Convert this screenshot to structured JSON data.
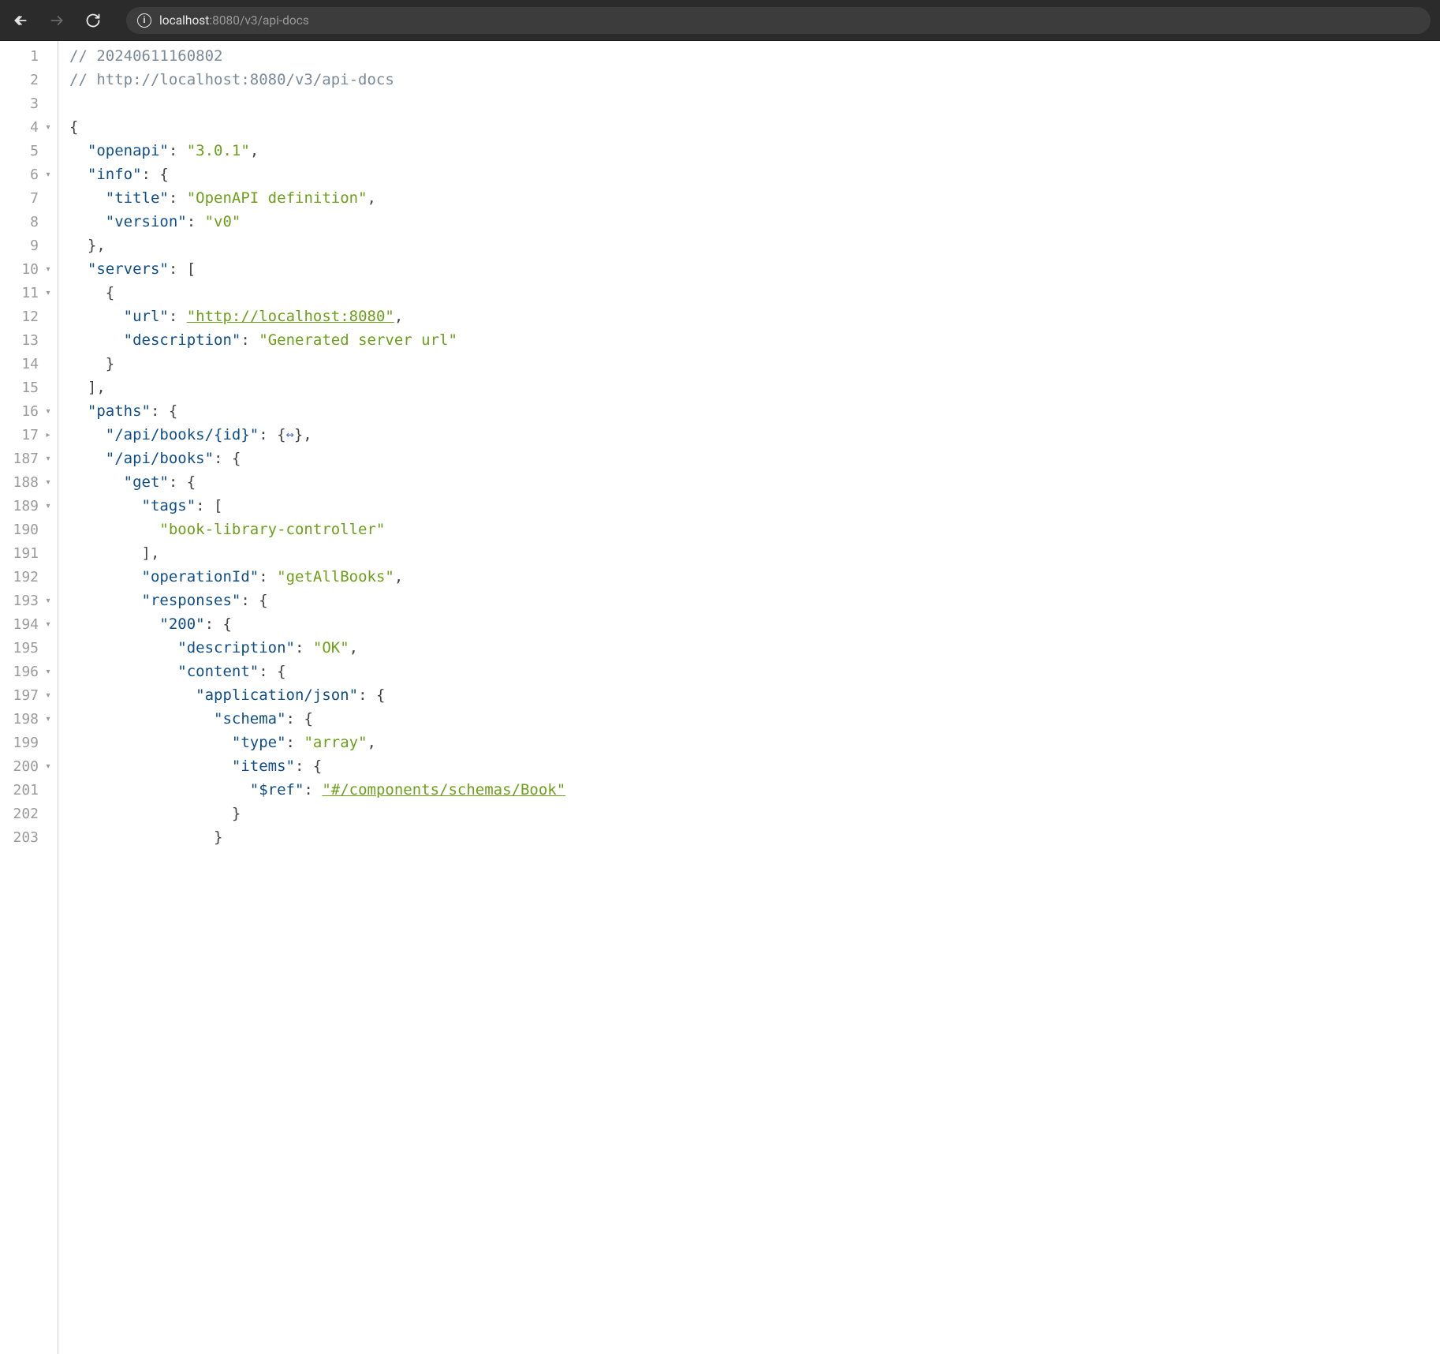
{
  "browser": {
    "url_host_prefix": "localhost",
    "url_host_suffix": ":8080",
    "url_path": "/v3/api-docs"
  },
  "lines": [
    {
      "n": "1",
      "fold": "",
      "tokens": [
        [
          "comment",
          "// 20240611160802"
        ]
      ]
    },
    {
      "n": "2",
      "fold": "",
      "tokens": [
        [
          "comment",
          "// http://localhost:8080/v3/api-docs"
        ]
      ]
    },
    {
      "n": "3",
      "fold": "",
      "tokens": []
    },
    {
      "n": "4",
      "fold": "▾",
      "tokens": [
        [
          "punct",
          "{"
        ]
      ]
    },
    {
      "n": "5",
      "fold": "",
      "tokens": [
        [
          "indent",
          "  "
        ],
        [
          "key",
          "\"openapi\""
        ],
        [
          "colon",
          ": "
        ],
        [
          "string",
          "\"3.0.1\""
        ],
        [
          "punct",
          ","
        ]
      ]
    },
    {
      "n": "6",
      "fold": "▾",
      "tokens": [
        [
          "indent",
          "  "
        ],
        [
          "key",
          "\"info\""
        ],
        [
          "colon",
          ": "
        ],
        [
          "punct",
          "{"
        ]
      ]
    },
    {
      "n": "7",
      "fold": "",
      "tokens": [
        [
          "indent",
          "    "
        ],
        [
          "key",
          "\"title\""
        ],
        [
          "colon",
          ": "
        ],
        [
          "string",
          "\"OpenAPI definition\""
        ],
        [
          "punct",
          ","
        ]
      ]
    },
    {
      "n": "8",
      "fold": "",
      "tokens": [
        [
          "indent",
          "    "
        ],
        [
          "key",
          "\"version\""
        ],
        [
          "colon",
          ": "
        ],
        [
          "string",
          "\"v0\""
        ]
      ]
    },
    {
      "n": "9",
      "fold": "",
      "tokens": [
        [
          "indent",
          "  "
        ],
        [
          "punct",
          "}"
        ],
        [
          "punct",
          ","
        ]
      ]
    },
    {
      "n": "10",
      "fold": "▾",
      "tokens": [
        [
          "indent",
          "  "
        ],
        [
          "key",
          "\"servers\""
        ],
        [
          "colon",
          ": "
        ],
        [
          "punct",
          "["
        ]
      ]
    },
    {
      "n": "11",
      "fold": "▾",
      "tokens": [
        [
          "indent",
          "    "
        ],
        [
          "punct",
          "{"
        ]
      ]
    },
    {
      "n": "12",
      "fold": "",
      "tokens": [
        [
          "indent",
          "      "
        ],
        [
          "key",
          "\"url\""
        ],
        [
          "colon",
          ": "
        ],
        [
          "link",
          "\"http://localhost:8080\""
        ],
        [
          "punct",
          ","
        ]
      ]
    },
    {
      "n": "13",
      "fold": "",
      "tokens": [
        [
          "indent",
          "      "
        ],
        [
          "key",
          "\"description\""
        ],
        [
          "colon",
          ": "
        ],
        [
          "string",
          "\"Generated server url\""
        ]
      ]
    },
    {
      "n": "14",
      "fold": "",
      "tokens": [
        [
          "indent",
          "    "
        ],
        [
          "punct",
          "}"
        ]
      ]
    },
    {
      "n": "15",
      "fold": "",
      "tokens": [
        [
          "indent",
          "  "
        ],
        [
          "punct",
          "]"
        ],
        [
          "punct",
          ","
        ]
      ]
    },
    {
      "n": "16",
      "fold": "▾",
      "tokens": [
        [
          "indent",
          "  "
        ],
        [
          "key",
          "\"paths\""
        ],
        [
          "colon",
          ": "
        ],
        [
          "punct",
          "{"
        ]
      ]
    },
    {
      "n": "17",
      "fold": "▸",
      "tokens": [
        [
          "indent",
          "    "
        ],
        [
          "key",
          "\"/api/books/{id}\""
        ],
        [
          "colon",
          ": "
        ],
        [
          "punct",
          "{"
        ],
        [
          "collapsed",
          "↔"
        ],
        [
          "punct",
          "}"
        ],
        [
          "punct",
          ","
        ]
      ]
    },
    {
      "n": "187",
      "fold": "▾",
      "tokens": [
        [
          "indent",
          "    "
        ],
        [
          "key",
          "\"/api/books\""
        ],
        [
          "colon",
          ": "
        ],
        [
          "punct",
          "{"
        ]
      ]
    },
    {
      "n": "188",
      "fold": "▾",
      "tokens": [
        [
          "indent",
          "      "
        ],
        [
          "key",
          "\"get\""
        ],
        [
          "colon",
          ": "
        ],
        [
          "punct",
          "{"
        ]
      ]
    },
    {
      "n": "189",
      "fold": "▾",
      "tokens": [
        [
          "indent",
          "        "
        ],
        [
          "key",
          "\"tags\""
        ],
        [
          "colon",
          ": "
        ],
        [
          "punct",
          "["
        ]
      ]
    },
    {
      "n": "190",
      "fold": "",
      "tokens": [
        [
          "indent",
          "          "
        ],
        [
          "string",
          "\"book-library-controller\""
        ]
      ]
    },
    {
      "n": "191",
      "fold": "",
      "tokens": [
        [
          "indent",
          "        "
        ],
        [
          "punct",
          "]"
        ],
        [
          "punct",
          ","
        ]
      ]
    },
    {
      "n": "192",
      "fold": "",
      "tokens": [
        [
          "indent",
          "        "
        ],
        [
          "key",
          "\"operationId\""
        ],
        [
          "colon",
          ": "
        ],
        [
          "string",
          "\"getAllBooks\""
        ],
        [
          "punct",
          ","
        ]
      ]
    },
    {
      "n": "193",
      "fold": "▾",
      "tokens": [
        [
          "indent",
          "        "
        ],
        [
          "key",
          "\"responses\""
        ],
        [
          "colon",
          ": "
        ],
        [
          "punct",
          "{"
        ]
      ]
    },
    {
      "n": "194",
      "fold": "▾",
      "tokens": [
        [
          "indent",
          "          "
        ],
        [
          "key",
          "\"200\""
        ],
        [
          "colon",
          ": "
        ],
        [
          "punct",
          "{"
        ]
      ]
    },
    {
      "n": "195",
      "fold": "",
      "tokens": [
        [
          "indent",
          "            "
        ],
        [
          "key",
          "\"description\""
        ],
        [
          "colon",
          ": "
        ],
        [
          "string",
          "\"OK\""
        ],
        [
          "punct",
          ","
        ]
      ]
    },
    {
      "n": "196",
      "fold": "▾",
      "tokens": [
        [
          "indent",
          "            "
        ],
        [
          "key",
          "\"content\""
        ],
        [
          "colon",
          ": "
        ],
        [
          "punct",
          "{"
        ]
      ]
    },
    {
      "n": "197",
      "fold": "▾",
      "tokens": [
        [
          "indent",
          "              "
        ],
        [
          "key",
          "\"application/json\""
        ],
        [
          "colon",
          ": "
        ],
        [
          "punct",
          "{"
        ]
      ]
    },
    {
      "n": "198",
      "fold": "▾",
      "tokens": [
        [
          "indent",
          "                "
        ],
        [
          "key",
          "\"schema\""
        ],
        [
          "colon",
          ": "
        ],
        [
          "punct",
          "{"
        ]
      ]
    },
    {
      "n": "199",
      "fold": "",
      "tokens": [
        [
          "indent",
          "                  "
        ],
        [
          "key",
          "\"type\""
        ],
        [
          "colon",
          ": "
        ],
        [
          "string",
          "\"array\""
        ],
        [
          "punct",
          ","
        ]
      ]
    },
    {
      "n": "200",
      "fold": "▾",
      "tokens": [
        [
          "indent",
          "                  "
        ],
        [
          "key",
          "\"items\""
        ],
        [
          "colon",
          ": "
        ],
        [
          "punct",
          "{"
        ]
      ]
    },
    {
      "n": "201",
      "fold": "",
      "tokens": [
        [
          "indent",
          "                    "
        ],
        [
          "key",
          "\"$ref\""
        ],
        [
          "colon",
          ": "
        ],
        [
          "link",
          "\"#/components/schemas/Book\""
        ]
      ]
    },
    {
      "n": "202",
      "fold": "",
      "tokens": [
        [
          "indent",
          "                  "
        ],
        [
          "punct",
          "}"
        ]
      ]
    },
    {
      "n": "203",
      "fold": "",
      "tokens": [
        [
          "indent",
          "                "
        ],
        [
          "punct",
          "}"
        ]
      ]
    }
  ]
}
